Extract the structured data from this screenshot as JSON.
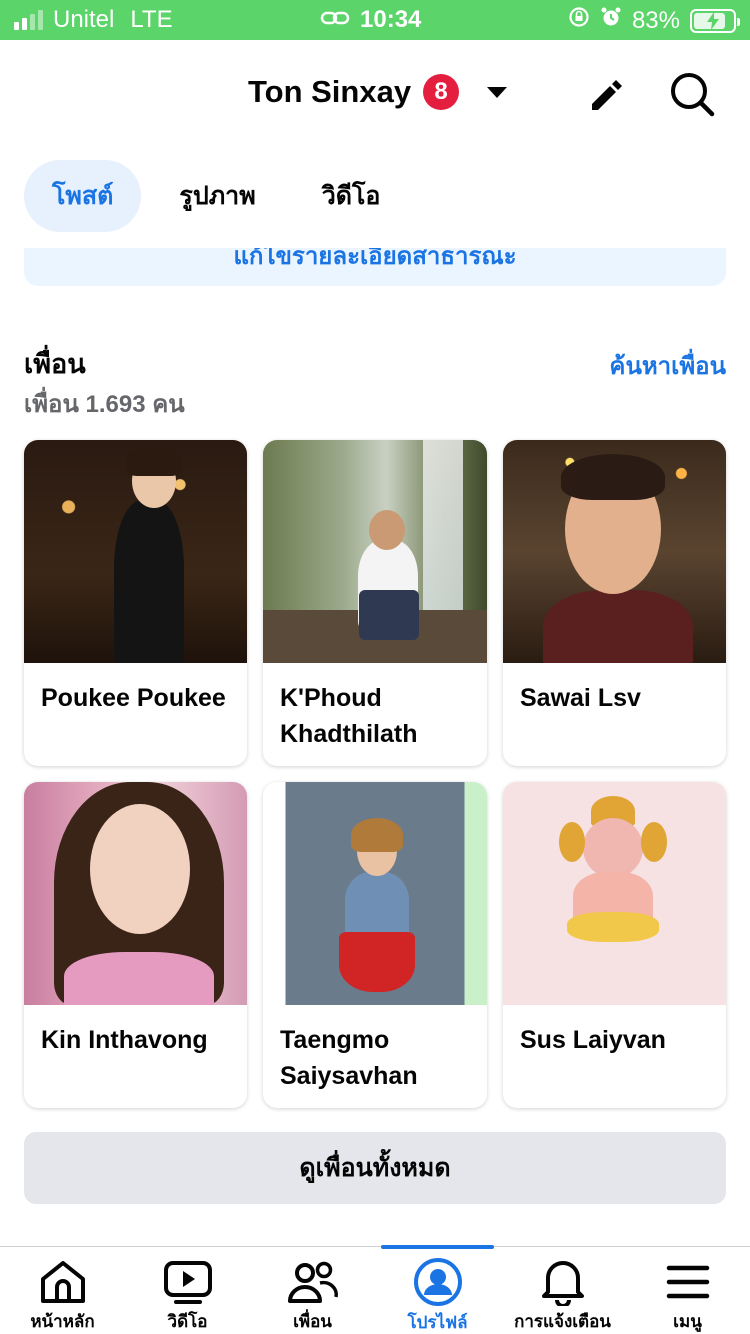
{
  "status_bar": {
    "carrier": "Unitel",
    "network": "LTE",
    "time": "10:34",
    "battery": "83%",
    "battery_level": 0.83
  },
  "header": {
    "profile_name": "Ton Sinxay",
    "notification_badge": "8",
    "icons": [
      "pencil-icon",
      "search-icon"
    ]
  },
  "tabs": [
    {
      "label": "โพสต์",
      "active": true
    },
    {
      "label": "รูปภาพ",
      "active": false
    },
    {
      "label": "วิดีโอ",
      "active": false
    }
  ],
  "edit_banner": {
    "label": "แก้ไขรายละเอียดสาธารณะ"
  },
  "friends": {
    "title": "เพื่อน",
    "count_label": "เพื่อน 1.693 คน",
    "find_link": "ค้นหาเพื่อน",
    "items": [
      {
        "name": "Poukee Poukee"
      },
      {
        "name": "K'Phoud Khadthilath"
      },
      {
        "name": "Sawai Lsv"
      },
      {
        "name": "Kin Inthavong"
      },
      {
        "name": "Taengmo Saiysavhan"
      },
      {
        "name": "Sus Laiyvan"
      }
    ],
    "see_all_button": "ดูเพื่อนทั้งหมด"
  },
  "bottom_nav": {
    "items": [
      {
        "label": "หน้าหลัก",
        "icon": "home-icon"
      },
      {
        "label": "วิดีโอ",
        "icon": "video-icon"
      },
      {
        "label": "เพื่อน",
        "icon": "friends-icon"
      },
      {
        "label": "โปรไฟล์",
        "icon": "profile-icon",
        "active": true
      },
      {
        "label": "การแจ้งเตือน",
        "icon": "bell-icon"
      },
      {
        "label": "เมนู",
        "icon": "menu-icon"
      }
    ]
  },
  "colors": {
    "status_bar": "#5bd46a",
    "accent": "#1b74e4",
    "badge": "#e41e3f",
    "see_all_bg": "#e4e6eb"
  }
}
